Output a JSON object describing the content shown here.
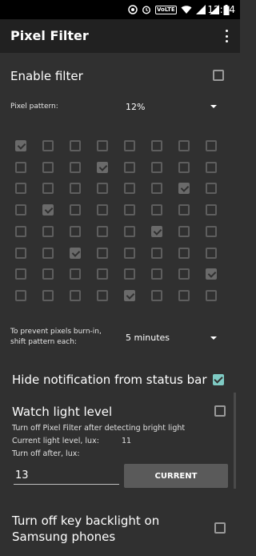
{
  "status_bar": {
    "time": "12:54",
    "volte": "VoLTE"
  },
  "app_bar": {
    "title": "Pixel Filter",
    "menu_icon": "overflow-menu-icon"
  },
  "enable_filter": {
    "label": "Enable filter",
    "checked": false
  },
  "pixel_pattern": {
    "label": "Pixel pattern:",
    "value": "12%"
  },
  "pattern_grid": {
    "rows": 8,
    "cols": 8,
    "checked": [
      [
        1,
        0,
        0,
        0,
        0,
        0,
        0,
        0
      ],
      [
        0,
        0,
        0,
        1,
        0,
        0,
        0,
        0
      ],
      [
        0,
        0,
        0,
        0,
        0,
        0,
        1,
        0
      ],
      [
        0,
        1,
        0,
        0,
        0,
        0,
        0,
        0
      ],
      [
        0,
        0,
        0,
        0,
        0,
        1,
        0,
        0
      ],
      [
        0,
        0,
        1,
        0,
        0,
        0,
        0,
        0
      ],
      [
        0,
        0,
        0,
        0,
        0,
        0,
        0,
        1
      ],
      [
        0,
        0,
        0,
        0,
        1,
        0,
        0,
        0
      ]
    ]
  },
  "shift_pattern": {
    "label_line1": "To prevent pixels burn-in,",
    "label_line2": "shift pattern each:",
    "value": "5 minutes"
  },
  "hide_notification": {
    "label": "Hide notification from status bar",
    "checked": true
  },
  "watch_light": {
    "label": "Watch light level",
    "checked": false,
    "description": "Turn off Pixel Filter after detecting bright light",
    "current_label": "Current light level, lux:",
    "current_value": "11",
    "turn_off_label": "Turn off after, lux:",
    "input_value": "13",
    "button_label": "CURRENT"
  },
  "key_backlight": {
    "label_line1": "Turn off key backlight on",
    "label_line2": "Samsung phones",
    "checked": false
  },
  "colors": {
    "background": "#303030",
    "app_bar": "#212121",
    "accent": "#7fcbc4",
    "button": "#5a5a5a"
  }
}
